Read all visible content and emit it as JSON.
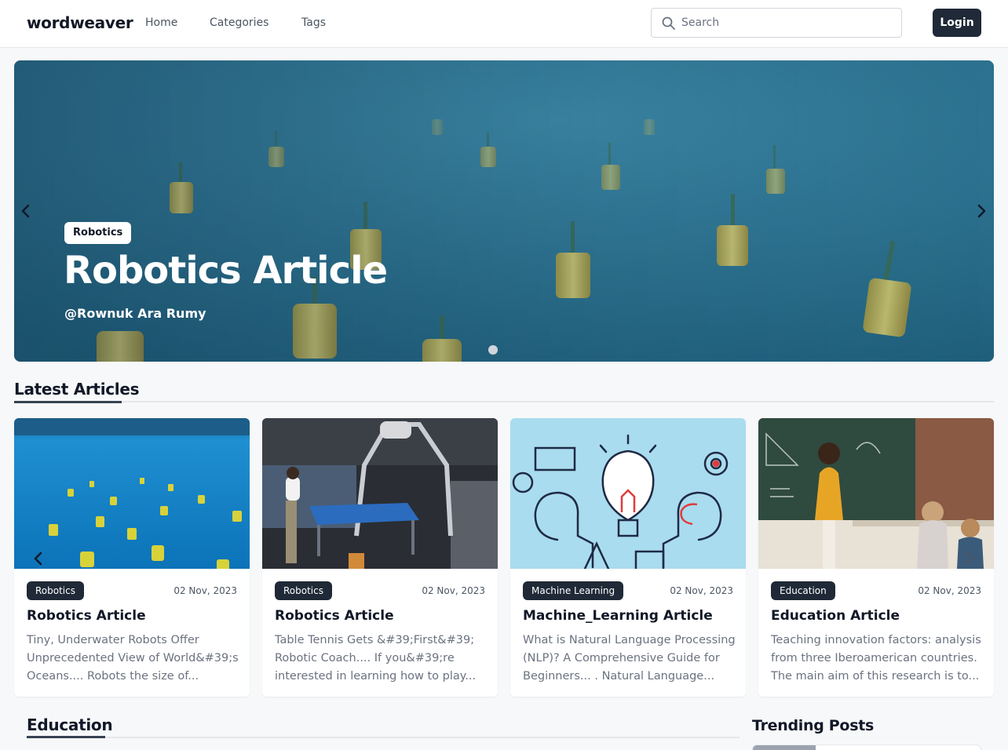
{
  "nav": {
    "brand": "wordweaver",
    "links": [
      "Home",
      "Categories",
      "Tags"
    ],
    "search_placeholder": "Search",
    "login_label": "Login"
  },
  "hero": {
    "category": "Robotics",
    "title": "Robotics Article",
    "author": "@Rownuk Ara Rumy",
    "slide_count": 1,
    "active_slide": 1
  },
  "latest": {
    "heading": "Latest Articles",
    "articles": [
      {
        "category": "Robotics",
        "date": "02 Nov, 2023",
        "title": "Robotics Article",
        "excerpt": "Tiny, Underwater Robots Offer Unprecedented View of World&#39;s Oceans.... Robots the size of..."
      },
      {
        "category": "Robotics",
        "date": "02 Nov, 2023",
        "title": "Robotics Article",
        "excerpt": "Table Tennis Gets &#39;First&#39; Robotic Coach.... If you&#39;re interested in learning how to play..."
      },
      {
        "category": "Machine Learning",
        "date": "02 Nov, 2023",
        "title": "Machine_Learning Article",
        "excerpt": "What is Natural Language Processing (NLP)? A Comprehensive Guide for Beginners... . Natural Language..."
      },
      {
        "category": "Education",
        "date": "02 Nov, 2023",
        "title": "Education Article",
        "excerpt": "Teaching innovation factors: analysis from three Iberoamerican countries. The main aim of this research is to..."
      }
    ]
  },
  "education": {
    "heading": "Education"
  },
  "trending": {
    "heading": "Trending Posts"
  },
  "colors": {
    "dark": "#1f2937",
    "hero_blue": "#2a7391",
    "page_bg": "#f7f8fa"
  }
}
